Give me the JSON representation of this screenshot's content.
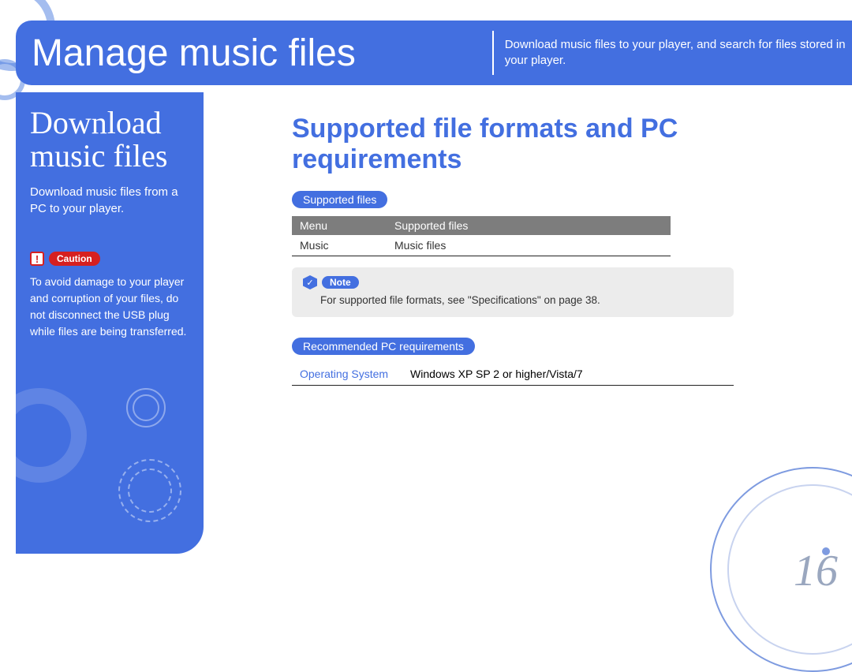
{
  "header": {
    "title": "Manage music files",
    "description": "Download music files to your player, and search for files stored in your player."
  },
  "sidebar": {
    "title": "Download music files",
    "subtitle": "Download music files from a PC to your player.",
    "caution_label": "Caution",
    "caution_text": "To avoid damage to your player and corruption of your files, do not disconnect the USB plug while files are being transferred."
  },
  "main": {
    "title": "Supported file formats and PC requirements",
    "supported_files_label": "Supported files",
    "table": {
      "col1_header": "Menu",
      "col2_header": "Supported files",
      "row1_col1": "Music",
      "row1_col2": "Music files"
    },
    "note_label": "Note",
    "note_text": "For supported file formats, see \"Specifications\" on page 38.",
    "pc_req_label": "Recommended PC requirements",
    "req_table": {
      "row1_label": "Operating System",
      "row1_value": "Windows XP SP 2 or higher/Vista/7"
    }
  },
  "page_number": "16"
}
